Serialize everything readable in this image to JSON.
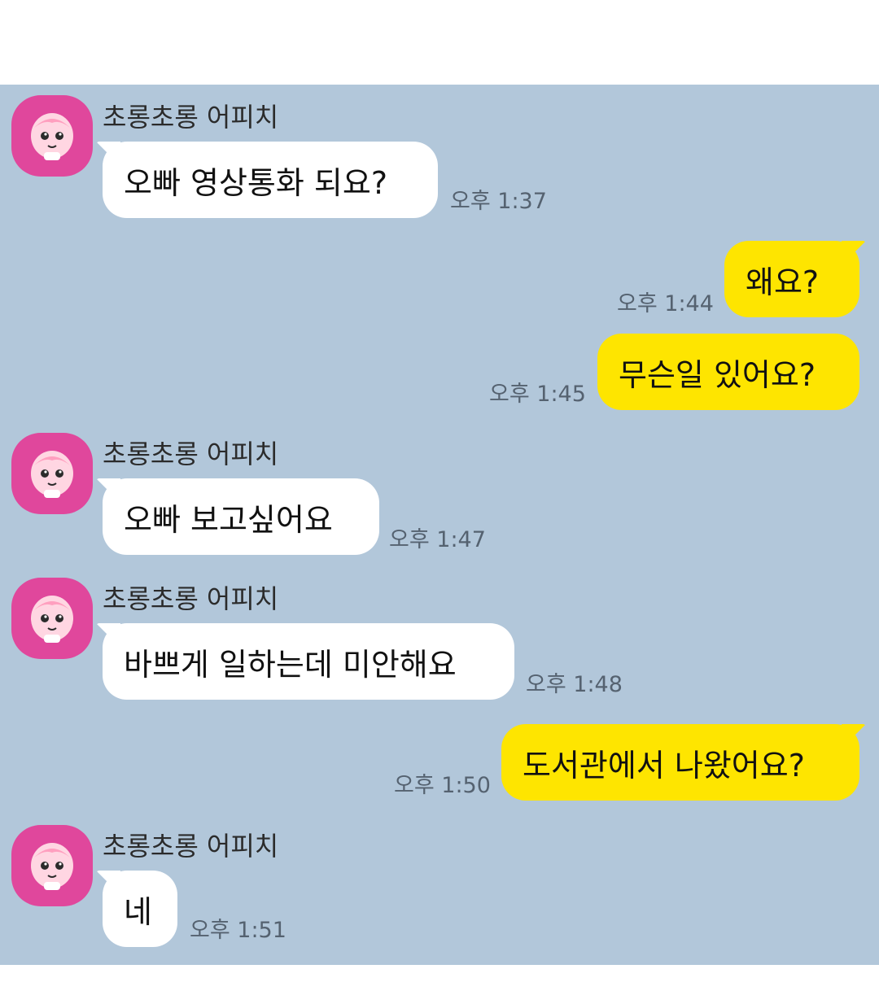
{
  "chat": {
    "messages": [
      {
        "direction": "in",
        "sender": "초롱초롱 어피치",
        "text": "오빠 영상통화 되요?",
        "time": "오후 1:37"
      },
      {
        "direction": "out",
        "text": "왜요?",
        "time": "오후 1:44"
      },
      {
        "direction": "out",
        "text": "무슨일 있어요?",
        "time": "오후 1:45"
      },
      {
        "direction": "in",
        "sender": "초롱초롱 어피치",
        "text": "오빠 보고싶어요",
        "time": "오후 1:47"
      },
      {
        "direction": "in",
        "sender": "초롱초롱 어피치",
        "text": "바쁘게 일하는데 미안해요",
        "time": "오후 1:48"
      },
      {
        "direction": "out",
        "text": "도서관에서 나왔어요?",
        "time": "오후 1:50"
      },
      {
        "direction": "in",
        "sender": "초롱초롱 어피치",
        "text": "네",
        "time": "오후 1:51"
      }
    ]
  },
  "colors": {
    "background": "#b2c7da",
    "incoming_bubble": "#ffffff",
    "outgoing_bubble": "#fee500",
    "avatar": "#e0479c"
  },
  "icons": {
    "avatar": "apeach-character-icon"
  }
}
